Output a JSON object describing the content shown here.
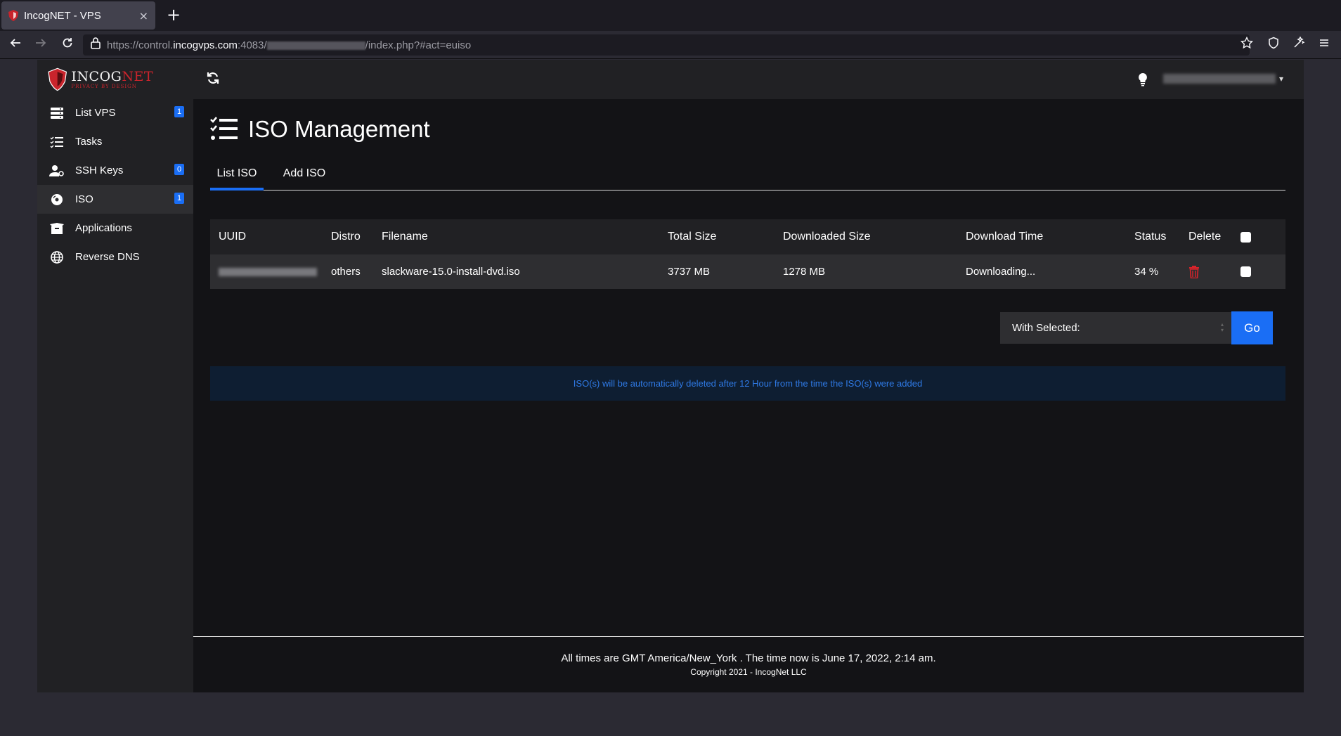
{
  "browser": {
    "tab_title": "IncogNET - VPS",
    "tab_close": "×",
    "new_tab": "+",
    "url_prefix": "https://control.",
    "url_host": "incogvps.com",
    "url_port_path": ":4083/",
    "url_suffix": "/index.php?#act=euiso"
  },
  "logo": {
    "name_a": "I",
    "name_b": "NCOG",
    "name_c": "NET",
    "tagline": "PRIVACY BY DESIGN"
  },
  "sidebar": {
    "items": [
      {
        "label": "List VPS",
        "badge": "1",
        "icon": "server-icon"
      },
      {
        "label": "Tasks",
        "badge": "",
        "icon": "tasks-icon"
      },
      {
        "label": "SSH Keys",
        "badge": "0",
        "icon": "user-key-icon"
      },
      {
        "label": "ISO",
        "badge": "1",
        "icon": "disc-icon"
      },
      {
        "label": "Applications",
        "badge": "",
        "icon": "box-icon"
      },
      {
        "label": "Reverse DNS",
        "badge": "",
        "icon": "globe-icon"
      }
    ]
  },
  "page": {
    "title": "ISO Management",
    "tabs": [
      "List ISO",
      "Add ISO"
    ]
  },
  "table": {
    "headers": [
      "UUID",
      "Distro",
      "Filename",
      "Total Size",
      "Downloaded Size",
      "Download Time",
      "Status",
      "Delete"
    ],
    "rows": [
      {
        "distro": "others",
        "filename": "slackware-15.0-install-dvd.iso",
        "total_size": "3737 MB",
        "downloaded_size": "1278 MB",
        "download_time": "Downloading...",
        "status": "34 %"
      }
    ]
  },
  "bulk": {
    "with_selected": "With Selected:",
    "go": "Go"
  },
  "notice": "ISO(s) will be automatically deleted after 12 Hour from the time the ISO(s) were added",
  "footer": {
    "line1": "All times are GMT America/New_York . The time now is June 17, 2022, 2:14 am.",
    "line2": "Copyright 2021 - IncogNet LLC"
  },
  "colors": {
    "accent": "#1a6ef5",
    "danger": "#d8232a",
    "brand_red": "#c9242c"
  }
}
